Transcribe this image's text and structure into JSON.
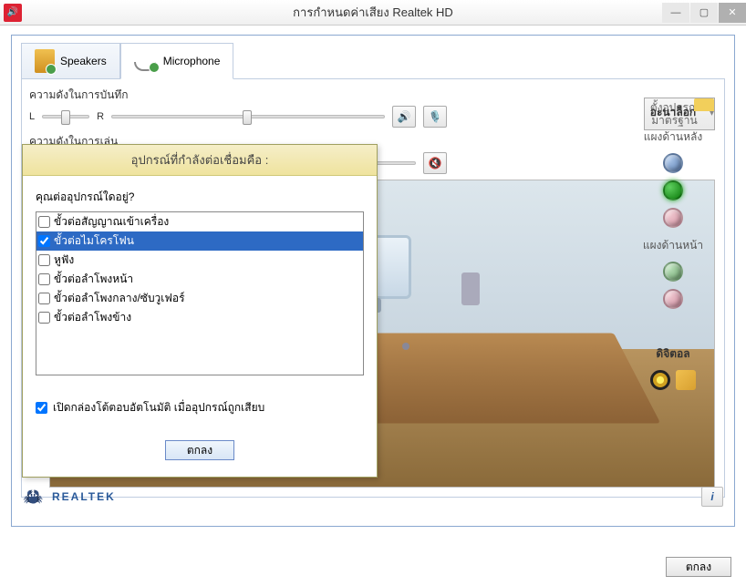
{
  "window": {
    "title": "การกำหนดค่าเสียง Realtek HD"
  },
  "tabs": {
    "speakers": "Speakers",
    "microphone": "Microphone"
  },
  "labels": {
    "recording_volume": "ความดังในการบันทึก",
    "playback_volume": "ความดังในการเล่น",
    "L": "L",
    "R": "R",
    "set_default": "ตั้งอุปกรณ์มาตรฐาน"
  },
  "sidebar": {
    "analog": "อะนาล็อก",
    "rear_panel": "แผงด้านหลัง",
    "front_panel": "แผงด้านหน้า",
    "digital": "ดิจิตอล"
  },
  "dialog": {
    "title": "อุปกรณ์ที่กำลังต่อเชื่อมคือ :",
    "question": "คุณต่ออุปกรณ์ใดอยู่?",
    "items": [
      {
        "label": "ขั้วต่อสัญญาณเข้าเครื่อง",
        "checked": false,
        "selected": false
      },
      {
        "label": "ขั้วต่อไมโครโฟน",
        "checked": true,
        "selected": true
      },
      {
        "label": "หูฟัง",
        "checked": false,
        "selected": false
      },
      {
        "label": "ขั้วต่อลำโพงหน้า",
        "checked": false,
        "selected": false
      },
      {
        "label": "ขั้วต่อลำโพงกลาง/ซับวูเฟอร์",
        "checked": false,
        "selected": false
      },
      {
        "label": "ขั้วต่อลำโพงข้าง",
        "checked": false,
        "selected": false
      }
    ],
    "auto_popup": "เปิดกล่องโต้ตอบอัตโนมัติ เมื่ออุปกรณ์ถูกเสียบ",
    "ok": "ตกลง"
  },
  "footer": {
    "brand": "REALTEK",
    "ok": "ตกลง"
  }
}
